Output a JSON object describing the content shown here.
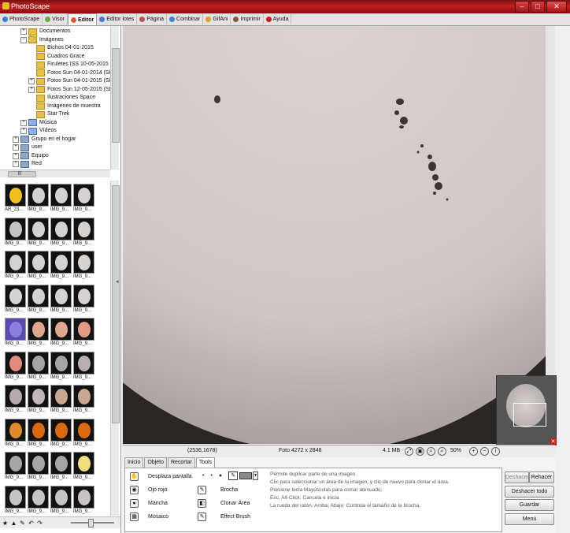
{
  "window": {
    "title": "PhotoScape",
    "min": "‒",
    "max": "□",
    "close": "✕"
  },
  "tabs": [
    {
      "label": "PhotoScape",
      "color": "#3b7dd8"
    },
    {
      "label": "Visor",
      "color": "#6aa84f"
    },
    {
      "label": "Editor",
      "color": "#d06030",
      "active": true
    },
    {
      "label": "Editor lotes",
      "color": "#4a7ac8"
    },
    {
      "label": "Página",
      "color": "#c0504d"
    },
    {
      "label": "Combinar",
      "color": "#4a7ac8"
    },
    {
      "label": "GifAni",
      "color": "#e0a020"
    },
    {
      "label": "Imprimir",
      "color": "#7a6040"
    },
    {
      "label": "Ayuda",
      "color": "#c02020"
    }
  ],
  "tree": [
    {
      "label": "Documentos",
      "indent": 2,
      "exp": "+",
      "kind": "folder"
    },
    {
      "label": "Imágenes",
      "indent": 2,
      "exp": "−",
      "kind": "folder"
    },
    {
      "label": "Bichos 04-01-2015",
      "indent": 3,
      "exp": "",
      "kind": "folder"
    },
    {
      "label": "Cuadros Grace",
      "indent": 3,
      "exp": "",
      "kind": "folder"
    },
    {
      "label": "Firuletes ISS 10-05-2015",
      "indent": 3,
      "exp": "",
      "kind": "folder"
    },
    {
      "label": "Fotos Sun 04-01-2014 (Sk",
      "indent": 3,
      "exp": "",
      "kind": "folder"
    },
    {
      "label": "Fotos Sun 04-01-2015 (Sk",
      "indent": 3,
      "exp": "+",
      "kind": "folder"
    },
    {
      "label": "Fotos Sun 12-05-2015  (SI",
      "indent": 3,
      "exp": "+",
      "kind": "folder"
    },
    {
      "label": "Ilustraciones Space",
      "indent": 3,
      "exp": "",
      "kind": "folder"
    },
    {
      "label": "Imágenes de muestra",
      "indent": 3,
      "exp": "",
      "kind": "folder"
    },
    {
      "label": "Star Trek",
      "indent": 3,
      "exp": "",
      "kind": "folder"
    },
    {
      "label": "Música",
      "indent": 2,
      "exp": "+",
      "kind": "media"
    },
    {
      "label": "Vídeos",
      "indent": 2,
      "exp": "+",
      "kind": "media"
    },
    {
      "label": "Grupo en el hogar",
      "indent": 1,
      "exp": "+",
      "kind": "pc"
    },
    {
      "label": "user",
      "indent": 1,
      "exp": "+",
      "kind": "pc"
    },
    {
      "label": "Equipo",
      "indent": 1,
      "exp": "+",
      "kind": "pc"
    },
    {
      "label": "Red",
      "indent": 1,
      "exp": "+",
      "kind": "pc"
    }
  ],
  "hscroll_label": "|||",
  "thumbnails": [
    {
      "caption": "AR_23...",
      "color": "#f0c020"
    },
    {
      "caption": "IMG_9...",
      "color": "#d6d2d0"
    },
    {
      "caption": "IMG_9...",
      "color": "#d6d2d0"
    },
    {
      "caption": "IMG_9...",
      "color": "#d6d2d0"
    },
    {
      "caption": "IMG_9...",
      "color": "#c8c4c4"
    },
    {
      "caption": "IMG_9...",
      "color": "#d6d2d0"
    },
    {
      "caption": "IMG_9...",
      "color": "#d6d2d0"
    },
    {
      "caption": "IMG_9...",
      "color": "#d6d2d0"
    },
    {
      "caption": "IMG_9...",
      "color": "#d6d2d0"
    },
    {
      "caption": "IMG_9...",
      "color": "#d6d2d0"
    },
    {
      "caption": "IMG_9...",
      "color": "#d6d2d0"
    },
    {
      "caption": "IMG_9...",
      "color": "#d6d2d0"
    },
    {
      "caption": "IMG_9...",
      "color": "#d6d2d0"
    },
    {
      "caption": "IMG_9...",
      "color": "#d6d2d0"
    },
    {
      "caption": "IMG_9...",
      "color": "#d6d2d0"
    },
    {
      "caption": "IMG_9...",
      "color": "#d6d2d0"
    },
    {
      "caption": "IMG_9...",
      "color": "#8a80e0"
    },
    {
      "caption": "IMG_9...",
      "color": "#e0a890"
    },
    {
      "caption": "IMG_9...",
      "color": "#e0a890"
    },
    {
      "caption": "IMG_9...",
      "color": "#e09a88"
    },
    {
      "caption": "IMG_9...",
      "color": "#e08a80"
    },
    {
      "caption": "IMG_9...",
      "color": "#a8a4a4"
    },
    {
      "caption": "IMG_9...",
      "color": "#a8a4a4"
    },
    {
      "caption": "IMG_9...",
      "color": "#b8b0b0"
    },
    {
      "caption": "IMG_9...",
      "color": "#b8a8b0"
    },
    {
      "caption": "IMG_9...",
      "color": "#c0b8b8"
    },
    {
      "caption": "IMG_9...",
      "color": "#c8a890"
    },
    {
      "caption": "IMG_9...",
      "color": "#c8a890"
    },
    {
      "caption": "IMG_9...",
      "color": "#e08a30"
    },
    {
      "caption": "IMG_9...",
      "color": "#d86a10"
    },
    {
      "caption": "IMG_9...",
      "color": "#d86a10"
    },
    {
      "caption": "IMG_9...",
      "color": "#d86a10"
    },
    {
      "caption": "IMG_9...",
      "color": "#a8a4a4"
    },
    {
      "caption": "IMG_9...",
      "color": "#a8a4a4"
    },
    {
      "caption": "IMG_9...",
      "color": "#a8a4a4"
    },
    {
      "caption": "IMG_9...",
      "color": "#f0e080"
    },
    {
      "caption": "IMG_9...",
      "color": "#c8c4c4"
    },
    {
      "caption": "IMG_9...",
      "color": "#c8c4c4"
    },
    {
      "caption": "IMG_9...",
      "color": "#c8c4c4"
    },
    {
      "caption": "IMG_9...",
      "color": "#c8c4c4"
    }
  ],
  "bottom_icons": [
    "★",
    "▲",
    "✎",
    "↶",
    "↷"
  ],
  "status": {
    "coords": "(2536,1678)",
    "photo_info": "Foto 4272 x 2848",
    "size": "4.1 MB",
    "zoom": "50%"
  },
  "subtabs": [
    "Inicio",
    "Objeto",
    "Recortar",
    "Tools"
  ],
  "tools_left": [
    {
      "label": "Desplaza pantalla",
      "icon": "✋"
    },
    {
      "label": "Ojo rojo",
      "icon": "◉"
    },
    {
      "label": "Mancha",
      "icon": "●"
    },
    {
      "label": "Mosaico",
      "icon": "▦"
    }
  ],
  "tools_right": [
    {
      "label": "Brocha",
      "icon": "✎"
    },
    {
      "label": "Clonar Área",
      "icon": "◧"
    },
    {
      "label": "Effect Brush",
      "icon": "✎"
    }
  ],
  "help_lines": [
    "Permite duplicar parte de una imagen.",
    "Clic para seleccionar un área de la imagen, y clic de nuevo para clonar el área.",
    "Presione tecla Mayúsculas para clonar atenuado.",
    "Esc, Alt-Click: Cancela e inicia",
    "La rueda del ratón, Arriba, Abajo: Controla el tamaño de la brocha."
  ],
  "buttons": {
    "undo": "Deshacer",
    "redo": "Rehacer",
    "undo_all": "Deshacer todo",
    "save": "Guardar",
    "menu": "Menú"
  }
}
